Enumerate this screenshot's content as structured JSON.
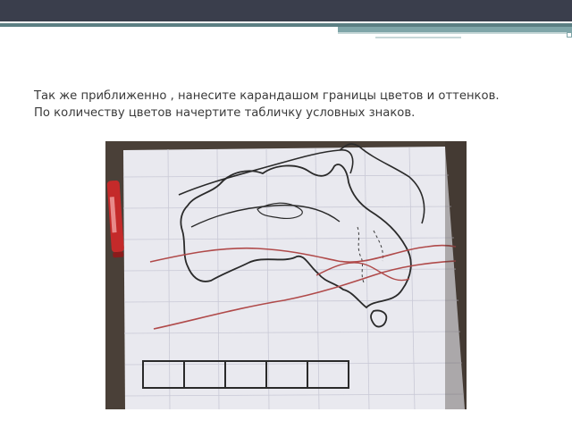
{
  "slide": {
    "line1": "Так же приближенно , нанесите карандашом границы цветов и оттенков.",
    "line2": "По количеству цветов начертите табличку условных знаков."
  },
  "colors": {
    "header_bar": "#3a3e4c",
    "accent": "#5b7f83",
    "text": "#3a3a3a",
    "marker_red": "#c42a2a",
    "contour_line": "#2a2a2a",
    "isoline_red": "#b04a4a"
  },
  "photo": {
    "subject": "hand-drawn contour map with isolines and legend table",
    "legend_cells": 5
  }
}
